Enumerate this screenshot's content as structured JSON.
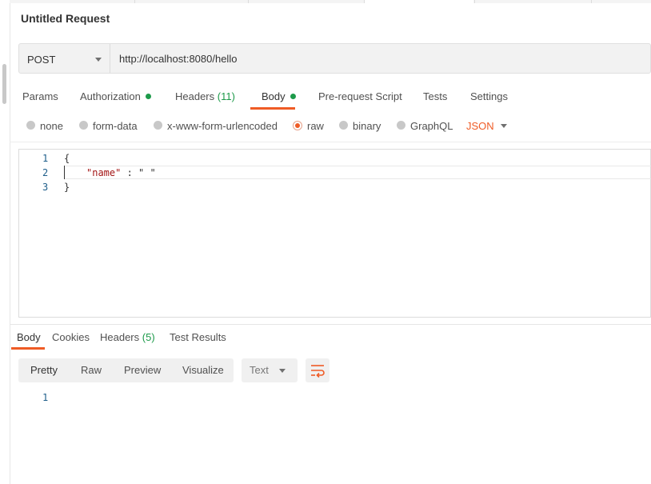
{
  "request": {
    "title": "Untitled Request",
    "method": "POST",
    "url": "http://localhost:8080/hello"
  },
  "request_tabs": [
    {
      "label": "Params"
    },
    {
      "label": "Authorization",
      "dot": true
    },
    {
      "label": "Headers",
      "count": "(11)"
    },
    {
      "label": "Body",
      "dot": true,
      "active": true
    },
    {
      "label": "Pre-request Script"
    },
    {
      "label": "Tests"
    },
    {
      "label": "Settings"
    }
  ],
  "body_types": [
    {
      "label": "none"
    },
    {
      "label": "form-data"
    },
    {
      "label": "x-www-form-urlencoded"
    },
    {
      "label": "raw",
      "selected": true
    },
    {
      "label": "binary"
    },
    {
      "label": "GraphQL"
    }
  ],
  "body_format": "JSON",
  "editor": {
    "line_numbers": [
      "1",
      "2",
      "3"
    ],
    "line1": "{",
    "line2_key": "\"name\"",
    "line2_sep": " : ",
    "line2_value": "\" \"",
    "line3": "}"
  },
  "response_tabs": [
    {
      "label": "Body",
      "active": true
    },
    {
      "label": "Cookies"
    },
    {
      "label": "Headers",
      "count": "(5)"
    },
    {
      "label": "Test Results"
    }
  ],
  "view_modes": [
    "Pretty",
    "Raw",
    "Preview",
    "Visualize"
  ],
  "active_view_mode": "Pretty",
  "response_format": "Text",
  "response_line_numbers": [
    "1"
  ],
  "colors": {
    "accent": "#ef5b25",
    "status_green": "#1d9a4a",
    "line_number": "#1e5e8a",
    "json_string": "#a31515"
  },
  "icons": {
    "method_dropdown": "chevron-down-icon",
    "format_dropdown": "chevron-down-icon",
    "wrap": "wrap-lines-icon"
  }
}
